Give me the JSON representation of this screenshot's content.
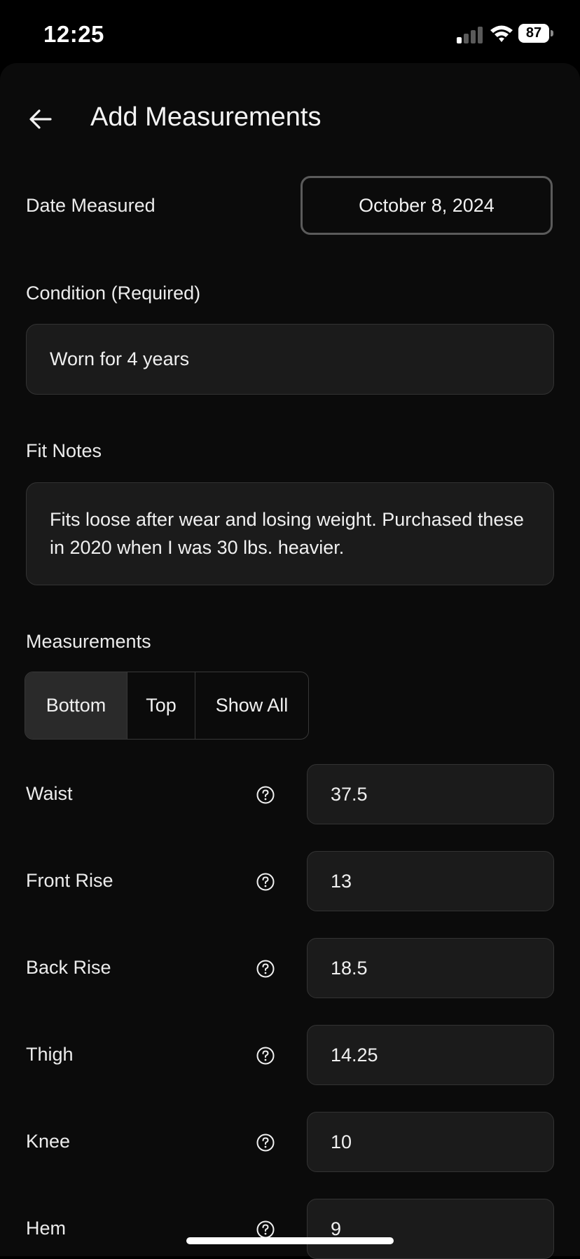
{
  "status_bar": {
    "time": "12:25",
    "battery": "87"
  },
  "header": {
    "title": "Add Measurements",
    "back_icon": "arrow-left-icon"
  },
  "date": {
    "label": "Date Measured",
    "value": "October 8, 2024"
  },
  "condition": {
    "label": "Condition (Required)",
    "value": "Worn for 4 years"
  },
  "fit_notes": {
    "label": "Fit Notes",
    "value": "Fits loose after wear and losing weight. Purchased these in 2020 when I was 30 lbs. heavier."
  },
  "measurements": {
    "label": "Measurements",
    "tabs": [
      {
        "label": "Bottom",
        "active": true
      },
      {
        "label": "Top",
        "active": false
      },
      {
        "label": "Show All",
        "active": false
      }
    ],
    "rows": [
      {
        "label": "Waist",
        "value": "37.5"
      },
      {
        "label": "Front Rise",
        "value": "13"
      },
      {
        "label": "Back Rise",
        "value": "18.5"
      },
      {
        "label": "Thigh",
        "value": "14.25"
      },
      {
        "label": "Knee",
        "value": "10"
      },
      {
        "label": "Hem",
        "value": "9"
      }
    ]
  },
  "colors": {
    "background": "#000000",
    "sheet": "#0b0b0b",
    "field": "#1b1b1b",
    "field_border": "#333333",
    "active_tab": "#2a2a2a"
  }
}
